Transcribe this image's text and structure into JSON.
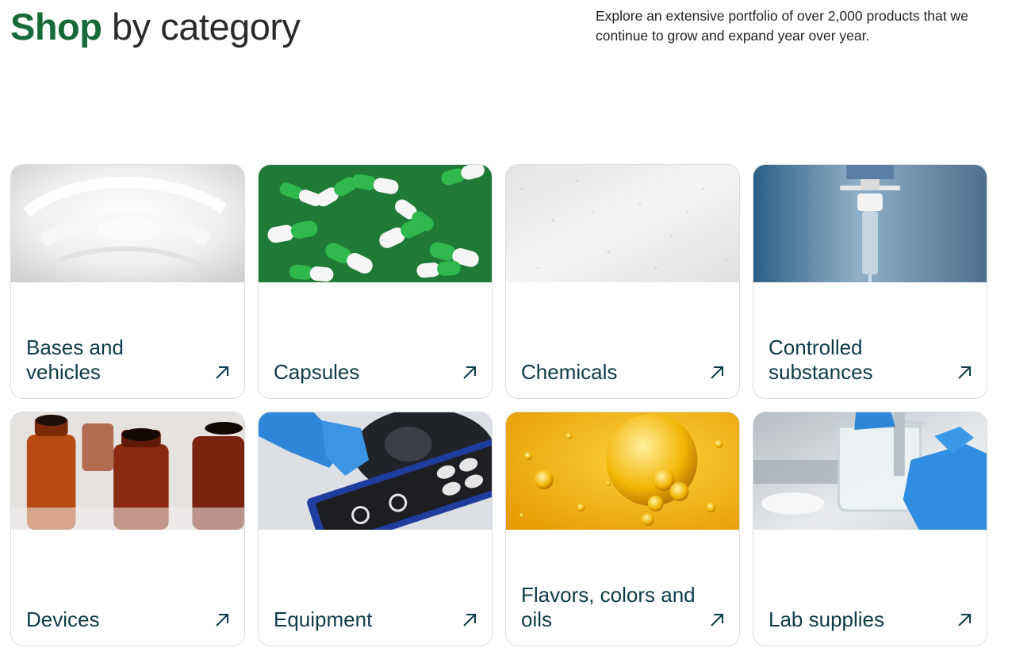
{
  "header": {
    "title_highlight": "Shop",
    "title_rest": "by category",
    "intro": "Explore an extensive portfolio of over 2,000 products that we continue to grow and expand year over year."
  },
  "categories": [
    {
      "label": "Bases and vehicles",
      "image": "white-cream-photo",
      "icon": "arrow-up-right-icon"
    },
    {
      "label": "Capsules",
      "image": "green-white-capsules-photo",
      "icon": "arrow-up-right-icon"
    },
    {
      "label": "Chemicals",
      "image": "white-powder-photo",
      "icon": "arrow-up-right-icon"
    },
    {
      "label": "Controlled substances",
      "image": "iv-drip-photo",
      "icon": "arrow-up-right-icon"
    },
    {
      "label": "Devices",
      "image": "amber-vials-photo",
      "icon": "arrow-up-right-icon"
    },
    {
      "label": "Equipment",
      "image": "lab-machine-gloved-hand-photo",
      "icon": "arrow-up-right-icon"
    },
    {
      "label": "Flavors, colors and oils",
      "image": "golden-oil-bubbles-photo",
      "icon": "arrow-up-right-icon"
    },
    {
      "label": "Lab supplies",
      "image": "glass-beaker-gloved-hand-photo",
      "icon": "arrow-up-right-icon"
    }
  ],
  "colors": {
    "brand_green": "#17693a",
    "text_teal": "#0d3b4a",
    "card_border": "#d9dee0"
  }
}
